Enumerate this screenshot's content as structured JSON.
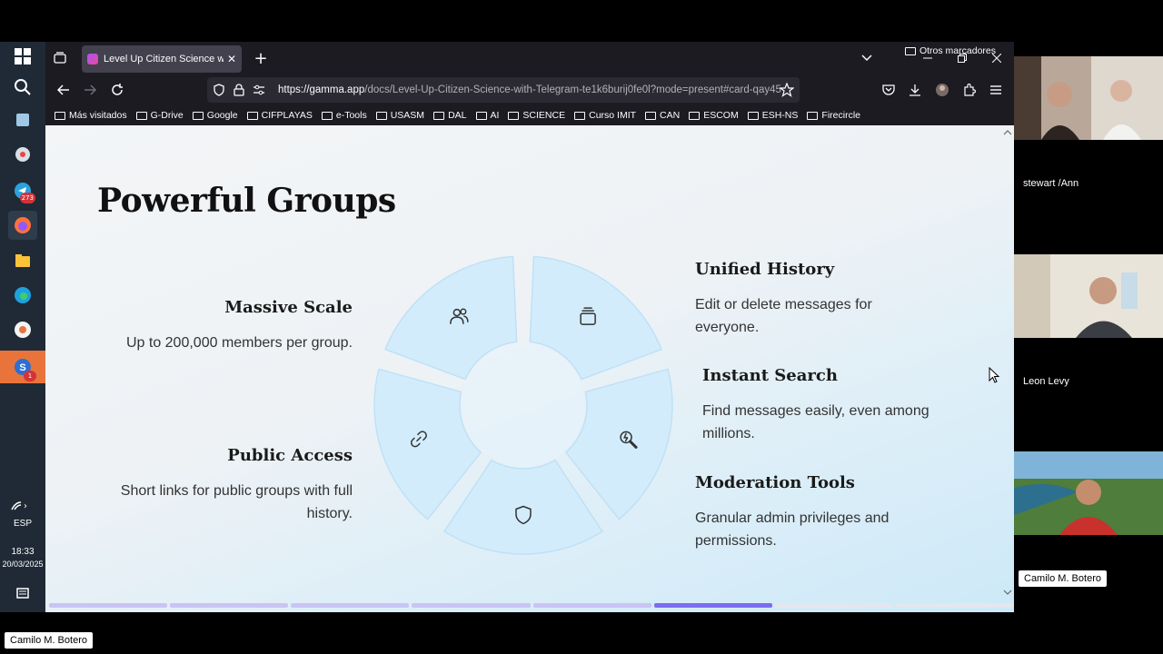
{
  "taskbar": {
    "telegram_badge": "273",
    "app_badge": "1",
    "language": "ESP",
    "time": "18:33",
    "date": "20/03/2025"
  },
  "browser": {
    "tab_title": "Level Up Citizen Science with Te",
    "url_host": "https://gamma.app",
    "url_path": "/docs/Level-Up-Citizen-Science-with-Telegram-te1k6burij0fe0l?mode=present#card-qay45",
    "bookmarks": [
      "Más visitados",
      "G-Drive",
      "Google",
      "CIFPLAYAS",
      "e-Tools",
      "USASM",
      "DAL",
      "AI",
      "SCIENCE",
      "Curso IMIT",
      "CAN",
      "ESCOM",
      "ESH-NS",
      "Firecircle"
    ],
    "other_bookmarks": "Otros marcadores"
  },
  "slide": {
    "title": "Powerful Groups",
    "features": [
      {
        "title": "Massive Scale",
        "desc": "Up to 200,000 members per group."
      },
      {
        "title": "Public Access",
        "desc": "Short links for public groups with full history."
      },
      {
        "title": "Unified History",
        "desc": "Edit or delete messages for everyone."
      },
      {
        "title": "Instant Search",
        "desc": "Find messages easily, even among millions."
      },
      {
        "title": "Moderation Tools",
        "desc": "Granular admin privileges and permissions."
      }
    ],
    "wheel_icons": [
      "users-icon",
      "stack-icon",
      "search-icon",
      "shield-icon",
      "link-icon"
    ],
    "progress": {
      "total": 8,
      "current": 6
    },
    "colors": {
      "segment_fill": "#d3ecfb",
      "segment_stroke": "#bfe1f6",
      "progress_active": "#7c6df0"
    }
  },
  "video": {
    "participants": [
      "stewart /Ann",
      "Leon Levy",
      "Camilo M. Botero"
    ],
    "bottom_label": "Camilo M. Botero"
  }
}
